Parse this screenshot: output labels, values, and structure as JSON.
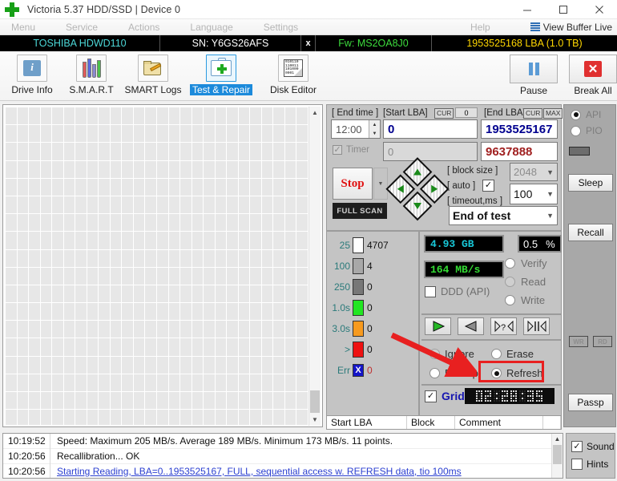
{
  "window": {
    "title": "Victoria 5.37 HDD/SSD | Device 0",
    "icon": "green-cross-icon",
    "minimize": "─",
    "maximize": "□",
    "close": "✕"
  },
  "menubar": {
    "items": [
      "Menu",
      "Service",
      "Actions",
      "Language",
      "Settings",
      "Help"
    ],
    "view_buffer_live": "View Buffer Live"
  },
  "drivebar": {
    "model": "TOSHIBA HDWD110",
    "serial": "SN: Y6GS26AFS",
    "x": "x",
    "firmware": "Fw: MS2OA8J0",
    "capacity": "1953525168 LBA (1.0 TB)"
  },
  "toolbar": {
    "tabs": [
      {
        "label": "Drive Info",
        "icon": "info-icon",
        "selected": false
      },
      {
        "label": "S.M.A.R.T",
        "icon": "test-tubes-icon",
        "selected": false
      },
      {
        "label": "SMART Logs",
        "icon": "folder-pen-icon",
        "selected": false
      },
      {
        "label": "Test & Repair",
        "icon": "first-aid-icon",
        "selected": true
      },
      {
        "label": "Disk Editor",
        "icon": "binary-page-icon",
        "selected": false
      }
    ],
    "binary_text": [
      "010110",
      "110011",
      "101000",
      "0001"
    ],
    "pause": "Pause",
    "break_all": "Break All"
  },
  "scan_params": {
    "end_time_label": "[ End time ]",
    "end_time_value": "12:00",
    "timer_label": "Timer",
    "timer_checked": true,
    "start_lba_label": "[Start LBA]",
    "start_lba_cur": "CUR",
    "start_lba_cur_value": "0",
    "start_lba_value": "0",
    "start_lba_second": "0",
    "end_lba_label": "[End LBA]",
    "end_lba_cur": "CUR",
    "end_lba_max": "MAX",
    "end_lba_value": "1953525167",
    "end_lba_second": "9637888",
    "stop_button": "Stop",
    "full_scan": "FULL SCAN",
    "block_size_label": "[ block size ]",
    "block_size_value": "2048",
    "auto_label": "[ auto ]",
    "auto_checked": true,
    "timeout_label": "[ timeout,ms ]",
    "timeout_value": "100",
    "end_of_test_value": "End of test"
  },
  "legend": {
    "rows": [
      {
        "time": "25",
        "color": "#ffffff",
        "count": "4707"
      },
      {
        "time": "100",
        "color": "#a8a8a8",
        "count": "4"
      },
      {
        "time": "250",
        "color": "#777777",
        "count": "0"
      },
      {
        "time": "1.0s",
        "color": "#22e622",
        "count": "0"
      },
      {
        "time": "3.0s",
        "color": "#f79a1e",
        "count": "0"
      },
      {
        "time": ">",
        "color": "#ee1111",
        "count": "0"
      },
      {
        "time": "Err",
        "color": "#1414c8",
        "count": "0",
        "mark": "X"
      }
    ]
  },
  "stats": {
    "size_done": "4.93 GB",
    "percent": "0.5",
    "percent_unit": "%",
    "speed": "164 MB/s",
    "ddd_api_label": "DDD (API)",
    "ddd_api_checked": false,
    "modes": [
      {
        "label": "Verify",
        "selected": false
      },
      {
        "label": "Read",
        "selected": false
      },
      {
        "label": "Write",
        "selected": false
      }
    ],
    "transport": [
      {
        "name": "play-forward-button",
        "glyph": "▶"
      },
      {
        "name": "play-backward-button",
        "glyph": "◀"
      },
      {
        "name": "random-scan-button",
        "glyph": "?"
      },
      {
        "name": "butterfly-scan-button",
        "glyph": "|"
      }
    ],
    "actions": [
      {
        "label": "Ignore",
        "selected": false,
        "disabled": true
      },
      {
        "label": "Erase",
        "selected": false,
        "disabled": false
      },
      {
        "label": "Remap",
        "selected": false,
        "disabled": false
      },
      {
        "label": "Refresh",
        "selected": true,
        "disabled": false,
        "highlighted": true
      }
    ],
    "grid_label": "Grid",
    "grid_checked": true,
    "clock": "02:28:35"
  },
  "table": {
    "headers": [
      "Start LBA",
      "Block",
      "Comment"
    ]
  },
  "sidebar": {
    "api_label": "API",
    "api_selected": true,
    "pio_label": "PIO",
    "pio_selected": false,
    "buttons": [
      "Sleep",
      "Recall",
      "Passp"
    ],
    "small_buttons": [
      "WR",
      "RD"
    ]
  },
  "log": {
    "rows": [
      {
        "time": "10:19:52",
        "text": "Speed: Maximum 205 MB/s. Average 189 MB/s. Minimum 173 MB/s. 11 points.",
        "link": false
      },
      {
        "time": "10:20:56",
        "text": "Recallibration... OK",
        "link": false
      },
      {
        "time": "10:20:56",
        "text": "Starting Reading, LBA=0..1953525167, FULL, sequential access w. REFRESH data, tio 100ms",
        "link": true
      }
    ]
  },
  "bottom_checks": [
    {
      "label": "Sound",
      "checked": true
    },
    {
      "label": "Hints",
      "checked": false
    }
  ],
  "annotation": {
    "arrow_color": "#e82020",
    "box_color": "#e82020",
    "points_to": "Refresh"
  }
}
